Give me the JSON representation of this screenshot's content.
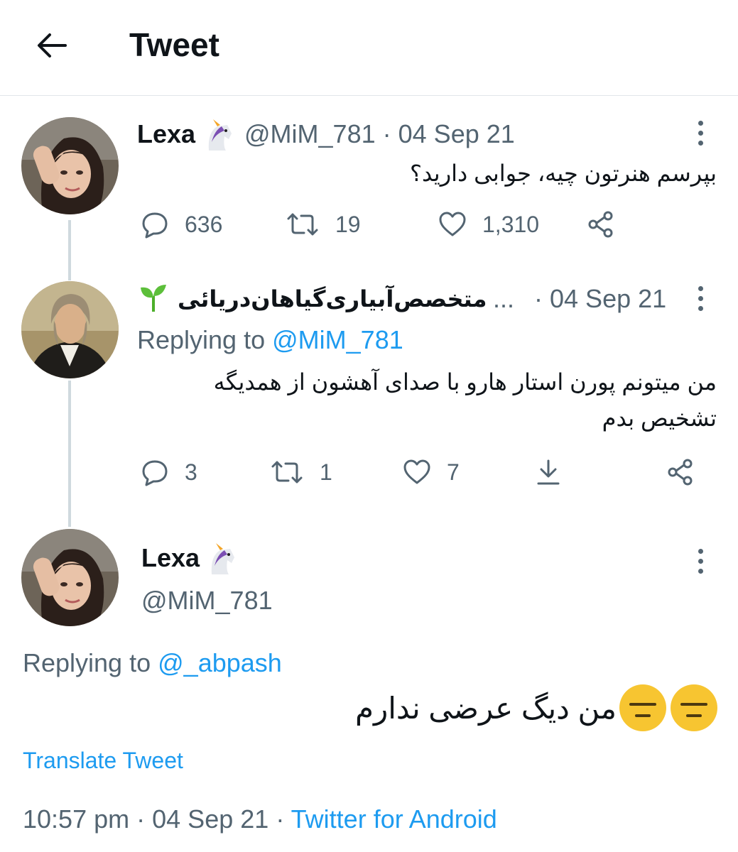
{
  "header": {
    "title": "Tweet"
  },
  "tweet1": {
    "name": "Lexa",
    "handle": "@MiM_781",
    "sep": "·",
    "date": "04 Sep 21",
    "text": "بپرسم هنرتون چیه، جوابی دارید؟",
    "replies": "636",
    "retweets": "19",
    "likes": "1,310"
  },
  "tweet2": {
    "name": "متخصص‌آبیاری‌گیاهان‌دریائی",
    "ellipsis": "...",
    "sep": "·",
    "date": "04 Sep 21",
    "replying_prefix": "Replying to",
    "replying_handle": "@MiM_781",
    "text_line1": "من میتونم پورن استار هارو با صدای آهشون از همدیگه",
    "text_line2": "تشخیص بدم",
    "replies": "3",
    "retweets": "1",
    "likes": "7"
  },
  "tweet3": {
    "name": "Lexa",
    "handle": "@MiM_781",
    "replying_prefix": "Replying to",
    "replying_handle": "@_abpash",
    "text": "من دیگ عرضی ندارم",
    "translate": "Translate Tweet",
    "time": "10:57 pm",
    "sep": "·",
    "date": "04 Sep 21",
    "source": "Twitter for Android"
  },
  "icons": {
    "back": "back-arrow-icon",
    "reply": "reply-icon",
    "retweet": "retweet-icon",
    "like": "heart-icon",
    "share": "share-icon",
    "download": "download-icon",
    "more": "more-icon",
    "unicorn": "unicorn-emoji",
    "seedling": "seedling-emoji",
    "expressionless": "expressionless-face-emoji"
  },
  "colors": {
    "accent": "#1d9bf0",
    "muted": "#536471",
    "text": "#0f1419",
    "thread": "#cfd9de"
  }
}
